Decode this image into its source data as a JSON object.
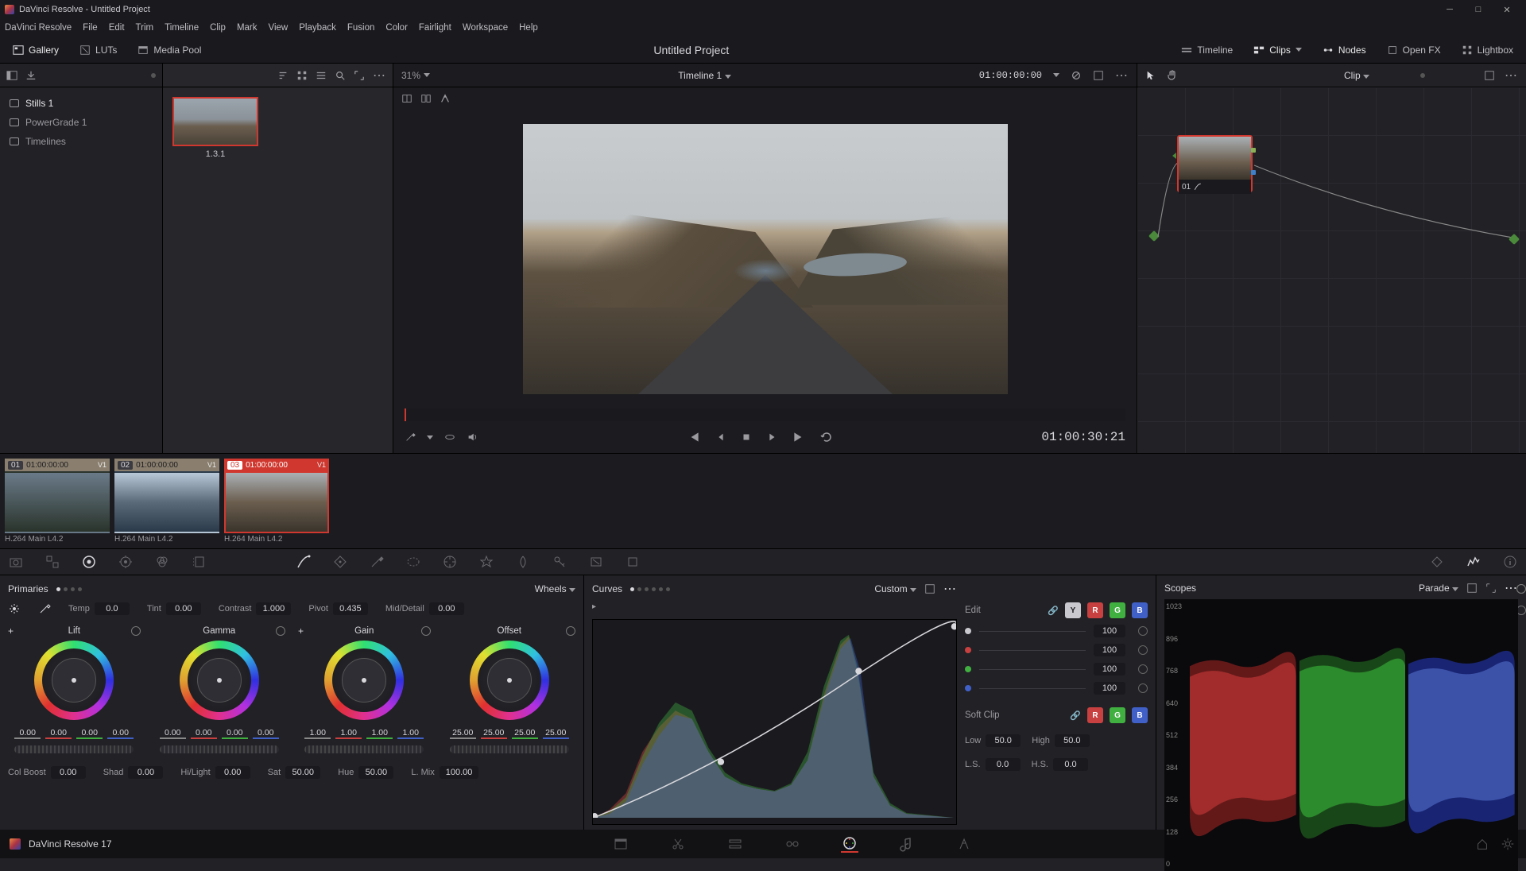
{
  "app": {
    "title": "DaVinci Resolve - Untitled Project"
  },
  "menubar": [
    "DaVinci Resolve",
    "File",
    "Edit",
    "Trim",
    "Timeline",
    "Clip",
    "Mark",
    "View",
    "Playback",
    "Fusion",
    "Color",
    "Fairlight",
    "Workspace",
    "Help"
  ],
  "top_tabs": {
    "gallery": "Gallery",
    "luts": "LUTs",
    "media_pool": "Media Pool",
    "project": "Untitled Project",
    "timeline": "Timeline",
    "clips": "Clips",
    "nodes": "Nodes",
    "openfx": "Open FX",
    "lightbox": "Lightbox"
  },
  "viewer": {
    "zoom": "31%",
    "timeline_name": "Timeline 1",
    "record_tc": "01:00:00:00",
    "playhead_tc": "01:00:30:21"
  },
  "nodes": {
    "mode": "Clip",
    "node01_label": "01"
  },
  "gallery_sidebar": {
    "stills": "Stills 1",
    "powergrade": "PowerGrade 1",
    "timelines": "Timelines"
  },
  "stills": {
    "s1": "1.3.1"
  },
  "clips": [
    {
      "num": "01",
      "tc": "01:00:00:00",
      "track": "V1",
      "codec": "H.264 Main L4.2"
    },
    {
      "num": "02",
      "tc": "01:00:00:00",
      "track": "V1",
      "codec": "H.264 Main L4.2"
    },
    {
      "num": "03",
      "tc": "01:00:00:00",
      "track": "V1",
      "codec": "H.264 Main L4.2"
    }
  ],
  "primaries": {
    "title": "Primaries",
    "mode": "Wheels",
    "temp_lbl": "Temp",
    "temp": "0.0",
    "tint_lbl": "Tint",
    "tint": "0.00",
    "contrast_lbl": "Contrast",
    "contrast": "1.000",
    "pivot_lbl": "Pivot",
    "pivot": "0.435",
    "md_lbl": "Mid/Detail",
    "md": "0.00",
    "lift": {
      "title": "Lift",
      "v": [
        "0.00",
        "0.00",
        "0.00",
        "0.00"
      ]
    },
    "gamma": {
      "title": "Gamma",
      "v": [
        "0.00",
        "0.00",
        "0.00",
        "0.00"
      ]
    },
    "gain": {
      "title": "Gain",
      "v": [
        "1.00",
        "1.00",
        "1.00",
        "1.00"
      ]
    },
    "offset": {
      "title": "Offset",
      "v": [
        "25.00",
        "25.00",
        "25.00",
        "25.00"
      ]
    },
    "colboost_lbl": "Col Boost",
    "colboost": "0.00",
    "shad_lbl": "Shad",
    "shad": "0.00",
    "hilight_lbl": "Hi/Light",
    "hilight": "0.00",
    "sat_lbl": "Sat",
    "sat": "50.00",
    "hue_lbl": "Hue",
    "hue": "50.00",
    "lmix_lbl": "L. Mix",
    "lmix": "100.00"
  },
  "curves": {
    "title": "Curves",
    "mode": "Custom",
    "edit": "Edit",
    "softclip": "Soft Clip",
    "chans": {
      "y": "Y",
      "r": "R",
      "g": "G",
      "b": "B"
    },
    "intensity": {
      "w": "100",
      "r": "100",
      "g": "100",
      "b": "100"
    },
    "low_lbl": "Low",
    "low": "50.0",
    "high_lbl": "High",
    "high": "50.0",
    "ls_lbl": "L.S.",
    "ls": "0.0",
    "hs_lbl": "H.S.",
    "hs": "0.0"
  },
  "scopes": {
    "title": "Scopes",
    "mode": "Parade",
    "axis": [
      "1023",
      "896",
      "768",
      "640",
      "512",
      "384",
      "256",
      "128",
      "0"
    ]
  },
  "footer": {
    "version": "DaVinci Resolve 17"
  }
}
